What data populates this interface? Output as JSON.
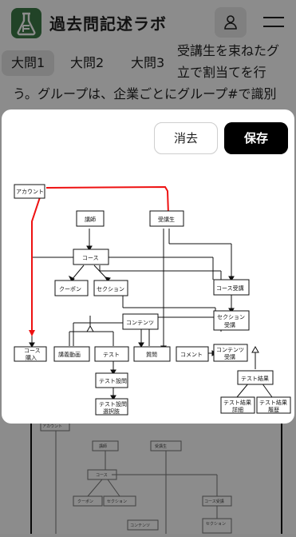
{
  "app": {
    "title": "過去問記述ラボ"
  },
  "icons": {
    "logo": "flask-icon",
    "user": "user-icon",
    "menu": "menu-icon"
  },
  "tabs": [
    {
      "label": "大問1",
      "active": true
    },
    {
      "label": "大問2"
    },
    {
      "label": "大問3"
    }
  ],
  "background_text": {
    "line1": "受講生を束ねたグ",
    "line2": "立で割当てを行",
    "line3": "う。グループは、企業ごとにグループ#で識別"
  },
  "modal": {
    "clear_label": "消去",
    "save_label": "保存"
  },
  "diagram": {
    "entities": {
      "account": "アカウント",
      "teacher": "講師",
      "student": "受講生",
      "course": "コース",
      "coupon": "クーポン",
      "section": "セクション",
      "course_enroll": "コース受講",
      "contents": "コンテンツ",
      "section_enroll_1": "セクション",
      "section_enroll_2": "受講",
      "course_buy_1": "コース",
      "course_buy_2": "購入",
      "lecture_video": "講義動画",
      "test": "テスト",
      "question": "質問",
      "comment": "コメント",
      "contents_enroll_1": "コンテンツ",
      "contents_enroll_2": "受講",
      "test_question": "テスト設問",
      "test_result": "テスト結果",
      "test_choice_1": "テスト設問",
      "test_choice_2": "選択肢",
      "test_result_detail_1": "テスト結果",
      "test_result_detail_2": "詳細",
      "test_result_history_1": "テスト結果",
      "test_result_history_2": "履歴"
    }
  }
}
